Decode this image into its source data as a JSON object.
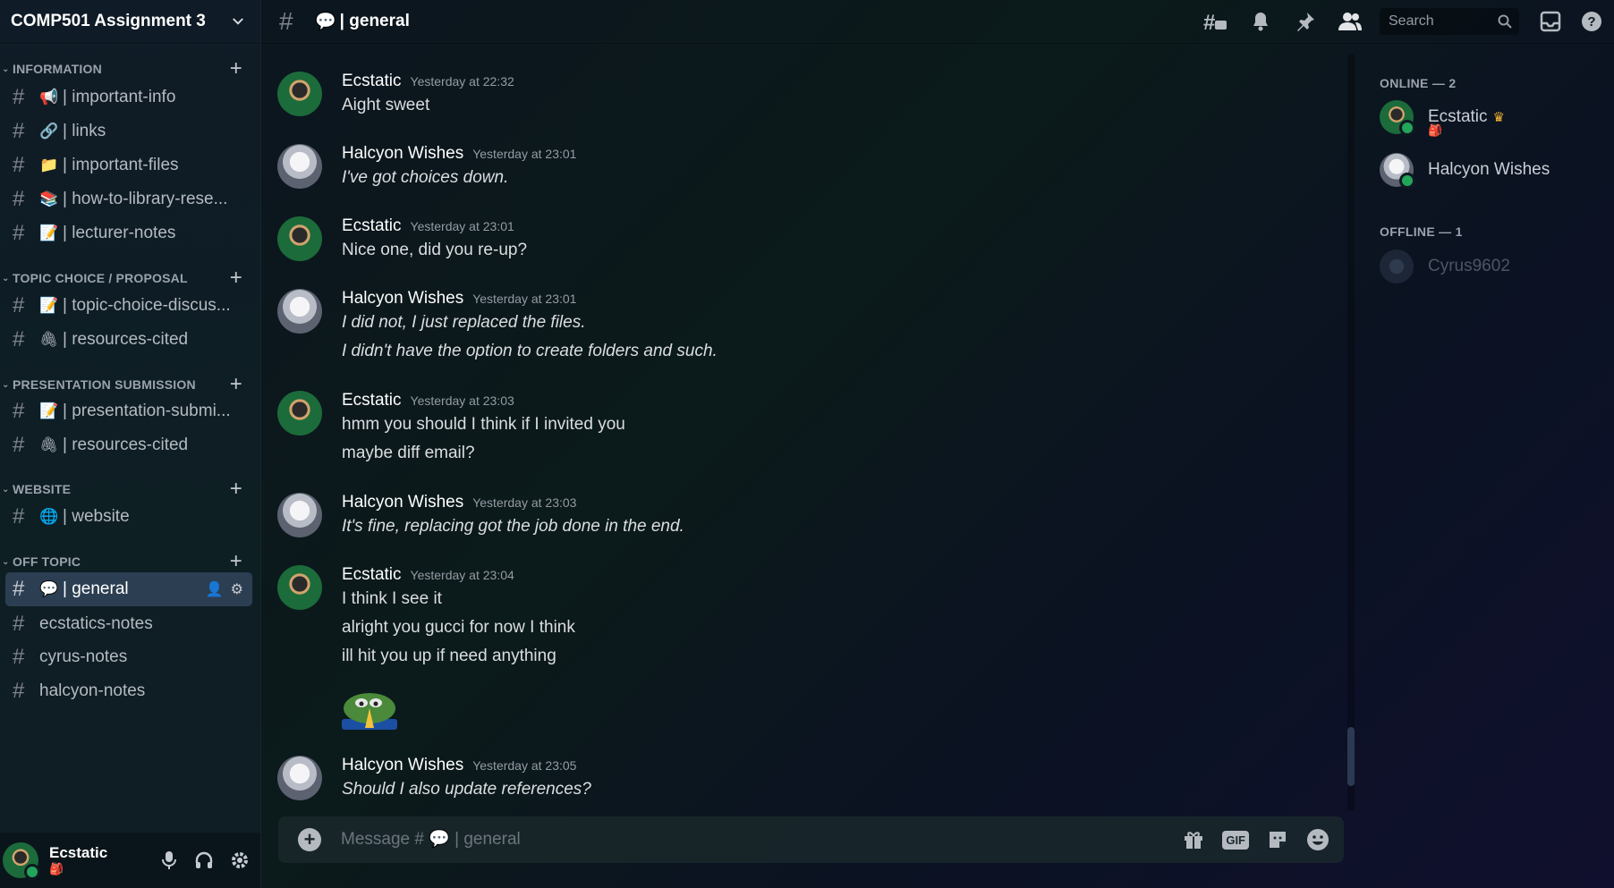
{
  "server": {
    "name": "COMP501 Assignment 3"
  },
  "categories": [
    {
      "name": "INFORMATION",
      "channels": [
        {
          "emoji": "📢",
          "label": "important-info"
        },
        {
          "emoji": "🔗",
          "label": "links"
        },
        {
          "emoji": "📁",
          "label": "important-files"
        },
        {
          "emoji": "📚",
          "label": "how-to-library-rese..."
        },
        {
          "emoji": "📝",
          "label": "lecturer-notes"
        }
      ]
    },
    {
      "name": "TOPIC CHOICE / PROPOSAL",
      "channels": [
        {
          "emoji": "📝",
          "label": "topic-choice-discus..."
        },
        {
          "emoji": "🖇",
          "label": "resources-cited"
        }
      ]
    },
    {
      "name": "PRESENTATION SUBMISSION",
      "channels": [
        {
          "emoji": "📝",
          "label": "presentation-submi..."
        },
        {
          "emoji": "🖇",
          "label": "resources-cited"
        }
      ]
    },
    {
      "name": "WEBSITE",
      "channels": [
        {
          "emoji": "🌐",
          "label": "website"
        }
      ]
    },
    {
      "name": "OFF TOPIC",
      "channels": [
        {
          "emoji": "💬",
          "label": "general",
          "active": true
        },
        {
          "emoji": "",
          "label": "ecstatics-notes"
        },
        {
          "emoji": "",
          "label": "cyrus-notes"
        },
        {
          "emoji": "",
          "label": "halcyon-notes"
        }
      ]
    }
  ],
  "current_user": {
    "name": "Ecstatic",
    "status_emoji": "🎒"
  },
  "topbar": {
    "channel_emoji": "💬",
    "channel_name": "| general",
    "search_placeholder": "Search",
    "icons": [
      "threads-icon",
      "bell-icon",
      "pin-icon",
      "members-icon",
      "inbox-icon",
      "help-icon"
    ]
  },
  "messages": [
    {
      "author": "Ecstatic",
      "time": "Yesterday at 22:32",
      "lines": [
        "Aight sweet"
      ],
      "italic": false
    },
    {
      "author": "Halcyon Wishes",
      "time": "Yesterday at 23:01",
      "lines": [
        "I've got choices down."
      ],
      "italic": true
    },
    {
      "author": "Ecstatic",
      "time": "Yesterday at 23:01",
      "lines": [
        "Nice one, did you re-up?"
      ],
      "italic": false
    },
    {
      "author": "Halcyon Wishes",
      "time": "Yesterday at 23:01",
      "lines": [
        "I did not, I just replaced the files.",
        "I didn't have the option to create folders and such."
      ],
      "italic": true
    },
    {
      "author": "Ecstatic",
      "time": "Yesterday at 23:03",
      "lines": [
        "hmm you should I think if I invited you",
        "maybe diff email?"
      ],
      "italic": false
    },
    {
      "author": "Halcyon Wishes",
      "time": "Yesterday at 23:03",
      "lines": [
        "It's fine, replacing got the job done in the end."
      ],
      "italic": true
    },
    {
      "author": "Ecstatic",
      "time": "Yesterday at 23:04",
      "lines": [
        "I think I see it",
        "alright you gucci for now I think",
        "ill hit you up if need anything"
      ],
      "italic": false,
      "sticker": "pepe-praying-sticker"
    },
    {
      "author": "Halcyon Wishes",
      "time": "Yesterday at 23:05",
      "lines": [
        "Should I also update references?"
      ],
      "italic": true
    }
  ],
  "composer": {
    "placeholder": "Message # 💬 | general"
  },
  "members": {
    "online_label": "ONLINE — 2",
    "offline_label": "OFFLINE — 1",
    "online": [
      {
        "name": "Ecstatic",
        "badge": "crown-icon",
        "status_emoji": "🎒"
      },
      {
        "name": "Halcyon Wishes"
      }
    ],
    "offline": [
      {
        "name": "Cyrus9602"
      }
    ]
  },
  "colors": {
    "online": "#23a55a",
    "active_channel": "#4a5f85",
    "status_red": "#d84b62"
  }
}
